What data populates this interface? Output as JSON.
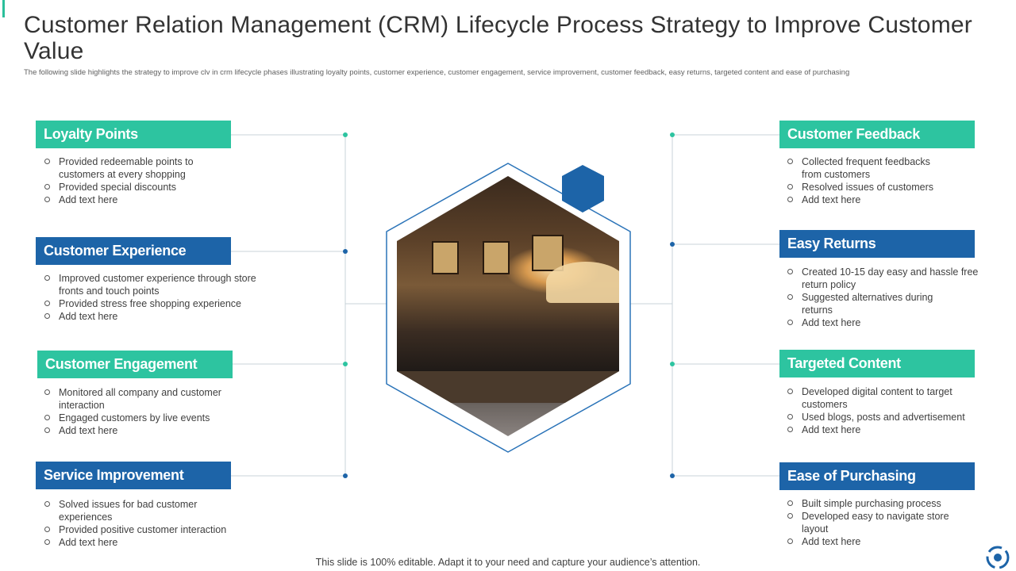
{
  "title": "Customer Relation Management (CRM) Lifecycle Process Strategy to Improve Customer Value",
  "subtitle": "The following slide highlights the strategy to improve clv in crm lifecycle phases illustrating loyalty points, customer experience, customer engagement,  service improvement, customer feedback, easy returns, targeted content and ease of purchasing",
  "colors": {
    "teal": "#2dc4a0",
    "blue": "#1d64a8",
    "outline": "#2a73b8"
  },
  "left_cards": [
    {
      "title": "Loyalty Points",
      "color": "teal",
      "bullets": [
        "Provided  redeemable  points to customers at every  shopping",
        "Provided  special discounts",
        "Add text here"
      ]
    },
    {
      "title": "Customer Experience",
      "color": "blue",
      "bullets": [
        "Improved  customer experience through store fronts and touch points",
        "Provided  stress free  shopping experience",
        "Add text here"
      ]
    },
    {
      "title": "Customer Engagement",
      "color": "teal",
      "bullets": [
        "Monitored all company and customer interaction",
        "Engaged customers by live  events",
        "Add text here"
      ]
    },
    {
      "title": "Service Improvement",
      "color": "blue",
      "bullets": [
        "Solved  issues for bad customer experiences",
        "Provided  positive  customer interaction",
        "Add text here"
      ]
    }
  ],
  "right_cards": [
    {
      "title": "Customer Feedback",
      "color": "teal",
      "bullets": [
        "Collected frequent feedbacks from customers",
        "Resolved  issues of customers",
        "Add text here"
      ]
    },
    {
      "title": "Easy Returns",
      "color": "blue",
      "bullets": [
        "Created  10-15 day easy and hassle free return  policy",
        "Suggested alternatives  during returns",
        "Add text here"
      ]
    },
    {
      "title": "Targeted Content",
      "color": "teal",
      "bullets": [
        "Developed  digital content to target customers",
        "Used blogs, posts and advertisement",
        "Add text here"
      ]
    },
    {
      "title": "Ease of Purchasing",
      "color": "blue",
      "bullets": [
        "Built simple  purchasing process",
        "Developed  easy to navigate  store layout",
        "Add text here"
      ]
    }
  ],
  "center_image": {
    "icon": "cafe-interior-photo"
  },
  "footer": "This slide is 100% editable. Adapt it to your need and capture your audience’s attention.",
  "corner_icon": "refresh-cycle-icon"
}
